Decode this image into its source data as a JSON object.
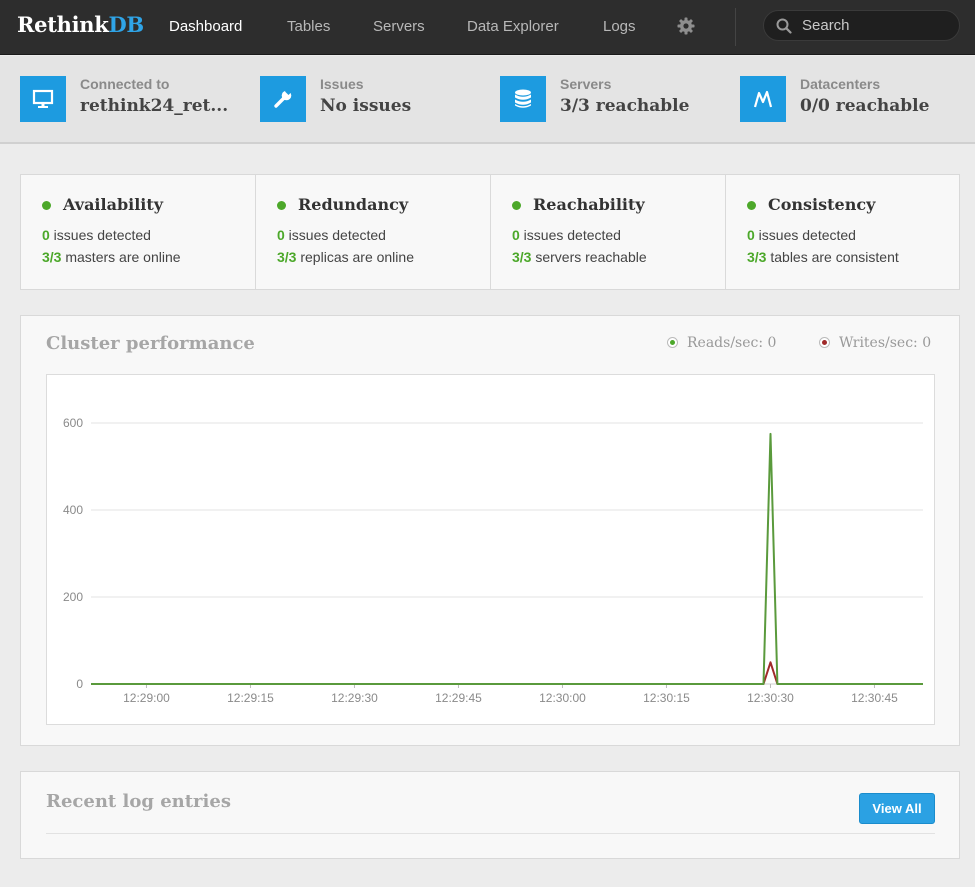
{
  "brand": {
    "name_a": "Rethink",
    "name_b": "DB"
  },
  "nav": {
    "items": [
      {
        "label": "Dashboard",
        "active": true
      },
      {
        "label": "Tables",
        "active": false
      },
      {
        "label": "Servers",
        "active": false
      },
      {
        "label": "Data Explorer",
        "active": false
      },
      {
        "label": "Logs",
        "active": false
      }
    ],
    "settings_icon": "gear-icon",
    "search": {
      "placeholder": "Search",
      "value": "",
      "icon": "search-icon"
    }
  },
  "status": [
    {
      "label": "Connected to",
      "value": "rethink24_ret...",
      "icon": "monitor-icon"
    },
    {
      "label": "Issues",
      "value": "No issues",
      "icon": "wrench-icon"
    },
    {
      "label": "Servers",
      "value": "3/3 reachable",
      "icon": "database-icon"
    },
    {
      "label": "Datacenters",
      "value": "0/0 reachable",
      "icon": "datacenter-icon"
    }
  ],
  "health": [
    {
      "title": "Availability",
      "l1_num": "0",
      "l1_text": " issues detected",
      "l2_num": "3/3",
      "l2_text": " masters are online"
    },
    {
      "title": "Redundancy",
      "l1_num": "0",
      "l1_text": " issues detected",
      "l2_num": "3/3",
      "l2_text": " replicas are online"
    },
    {
      "title": "Reachability",
      "l1_num": "0",
      "l1_text": " issues detected",
      "l2_num": "3/3",
      "l2_text": " servers reachable"
    },
    {
      "title": "Consistency",
      "l1_num": "0",
      "l1_text": " issues detected",
      "l2_num": "3/3",
      "l2_text": " tables are consistent"
    }
  ],
  "colors": {
    "accent": "#1d9be0",
    "ok": "#4ca82a",
    "reads": "#5a9a3c",
    "writes": "#a02a2a"
  },
  "performance": {
    "title": "Cluster performance",
    "reads_label": "Reads/sec: 0",
    "writes_label": "Writes/sec: 0"
  },
  "chart_data": {
    "type": "line",
    "title": "Cluster performance",
    "xlabel": "",
    "ylabel": "",
    "ylim": [
      0,
      600
    ],
    "yticks": [
      0,
      200,
      400,
      600
    ],
    "xlim": [
      "12:28:52",
      "12:30:52"
    ],
    "xticks": [
      "12:29:00",
      "12:29:15",
      "12:29:30",
      "12:29:45",
      "12:30:00",
      "12:30:15",
      "12:30:30",
      "12:30:45"
    ],
    "grid": true,
    "legend": "top-right",
    "series": [
      {
        "name": "Reads/sec",
        "x": [
          "12:28:52",
          "12:30:28",
          "12:30:29",
          "12:30:30",
          "12:30:31",
          "12:30:52"
        ],
        "values": [
          0,
          0,
          0,
          575,
          0,
          0
        ]
      },
      {
        "name": "Writes/sec",
        "x": [
          "12:28:52",
          "12:30:28",
          "12:30:29",
          "12:30:30",
          "12:30:31",
          "12:30:52"
        ],
        "values": [
          0,
          0,
          0,
          50,
          0,
          0
        ]
      }
    ]
  },
  "logs": {
    "title": "Recent log entries",
    "view_all_label": "View All"
  }
}
